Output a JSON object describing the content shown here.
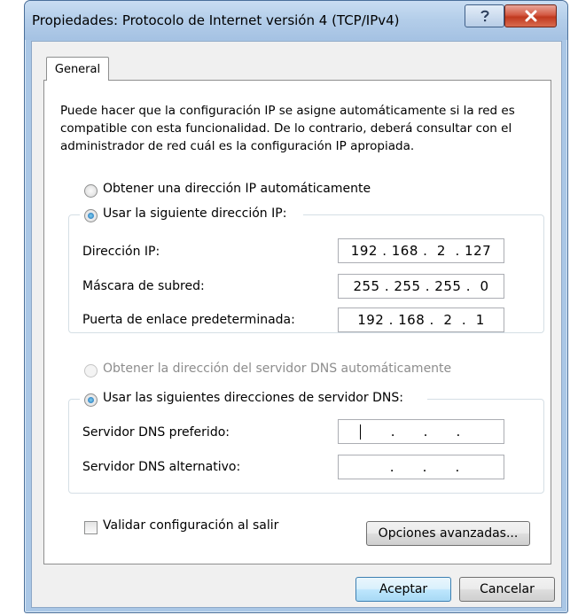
{
  "window": {
    "title": "Propiedades: Protocolo de Internet versión 4 (TCP/IPv4)"
  },
  "tabs": [
    {
      "label": "General",
      "selected": true
    }
  ],
  "description": "Puede hacer que la configuración IP se asigne automáticamente si la red es compatible con esta funcionalidad. De lo contrario, deberá consultar con el administrador de red cuál es la configuración IP apropiada.",
  "ip": {
    "auto_label": "Obtener una dirección IP automáticamente",
    "manual_label": "Usar la siguiente dirección IP:",
    "selected": "manual",
    "fields": [
      {
        "label": "Dirección IP:",
        "value": "192 . 168 .  2  . 127"
      },
      {
        "label": "Máscara de subred:",
        "value": "255 . 255 . 255 .  0"
      },
      {
        "label": "Puerta de enlace predeterminada:",
        "value": "192 . 168 .  2  .  1"
      }
    ]
  },
  "dns": {
    "auto_label": "Obtener la dirección del servidor DNS automáticamente",
    "manual_label": "Usar las siguientes direcciones de servidor DNS:",
    "selected": "manual",
    "auto_disabled": true,
    "fields": [
      {
        "label": "Servidor DNS preferido:",
        "value": "   .      .      ."
      },
      {
        "label": "Servidor DNS alternativo:",
        "value": "   .      .      ."
      }
    ]
  },
  "validate": {
    "label": "Validar configuración al salir",
    "checked": false
  },
  "buttons": {
    "advanced": "Opciones avanzadas...",
    "ok": "Aceptar",
    "cancel": "Cancelar"
  },
  "icons": {
    "help": "help-icon",
    "close": "close-icon"
  },
  "colors": {
    "title_bar": "#b3cde9",
    "close_button": "#c0391f",
    "default_button_border": "#3c7fb1"
  }
}
